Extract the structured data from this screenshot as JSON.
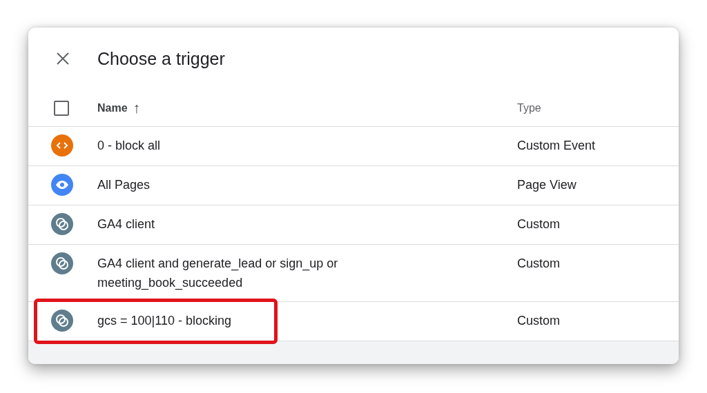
{
  "dialog": {
    "title": "Choose a trigger"
  },
  "table": {
    "select_all": {
      "checked": false
    },
    "columns": [
      {
        "label": "Name",
        "sort_icon": "↑"
      },
      {
        "label": "Type"
      }
    ],
    "rows": [
      {
        "kind": "custom_event",
        "name": "0 - block all",
        "type": "Custom Event",
        "highlighted": false
      },
      {
        "kind": "page_view",
        "name": "All Pages",
        "type": "Page View",
        "highlighted": false
      },
      {
        "kind": "custom",
        "name": "GA4 client",
        "type": "Custom",
        "highlighted": false
      },
      {
        "kind": "custom",
        "name": "GA4 client and generate_lead or sign_up or meeting_book_succeeded",
        "type": "Custom",
        "highlighted": false
      },
      {
        "kind": "custom",
        "name": "gcs = 100|110 - blocking",
        "type": "Custom",
        "highlighted": true
      }
    ]
  }
}
